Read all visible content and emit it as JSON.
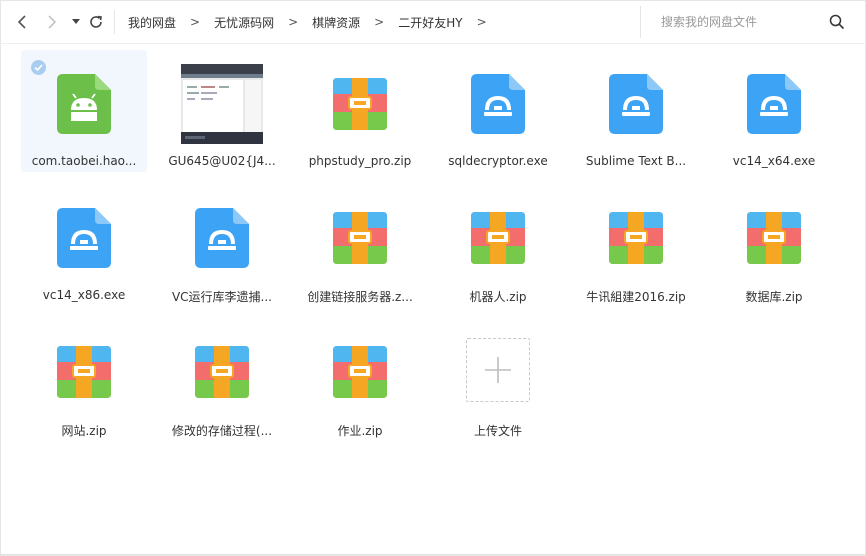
{
  "toolbar": {
    "breadcrumb": [
      "我的网盘",
      "无忧源码网",
      "棋牌资源",
      "二开好友HY"
    ],
    "crumb_sep": ">",
    "search_placeholder": "搜索我的网盘文件"
  },
  "files": [
    {
      "name": "com.taobei.hao...",
      "type": "android-apk",
      "selected": true
    },
    {
      "name": "GU645@U02{J4...",
      "type": "image-thumbnail",
      "selected": false
    },
    {
      "name": "phpstudy_pro.zip",
      "type": "zip",
      "selected": false
    },
    {
      "name": "sqldecryptor.exe",
      "type": "exe",
      "selected": false
    },
    {
      "name": "Sublime Text B...",
      "type": "exe",
      "selected": false
    },
    {
      "name": "vc14_x64.exe",
      "type": "exe",
      "selected": false
    },
    {
      "name": "vc14_x86.exe",
      "type": "exe",
      "selected": false
    },
    {
      "name": "VC运行库李遗捕...",
      "type": "exe",
      "selected": false
    },
    {
      "name": "创建链接服务器.z...",
      "type": "zip",
      "selected": false
    },
    {
      "name": "机器人.zip",
      "type": "zip",
      "selected": false
    },
    {
      "name": "牛讯組建2016.zip",
      "type": "zip",
      "selected": false
    },
    {
      "name": "数据库.zip",
      "type": "zip",
      "selected": false
    },
    {
      "name": "网站.zip",
      "type": "zip",
      "selected": false
    },
    {
      "name": "修改的存储过程(...",
      "type": "zip",
      "selected": false
    },
    {
      "name": "作业.zip",
      "type": "zip",
      "selected": false
    }
  ],
  "upload": {
    "label": "上传文件"
  },
  "colors": {
    "android_green": "#6cc04a",
    "exe_blue": "#3ca3f5",
    "zip_blue": "#4fb6ef",
    "zip_red": "#f36d6d",
    "zip_green": "#77c94b",
    "zip_orange": "#f5a623",
    "selected_bg": "#f1f7fd"
  }
}
